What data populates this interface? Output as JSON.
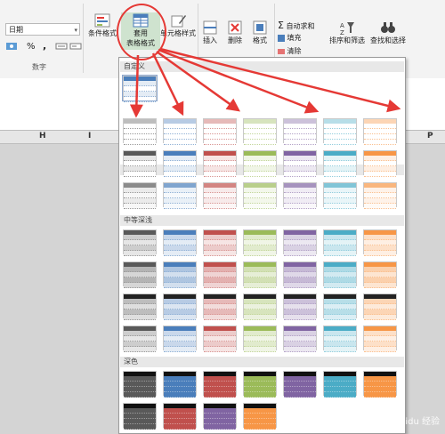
{
  "ribbon": {
    "number_format_value": "日期",
    "percent_symbol": "%",
    "comma_symbol": ",",
    "group_number_label": "数字",
    "conditional_format_label": "条件格式",
    "format_as_table_line1": "套用",
    "format_as_table_line2": "表格格式",
    "cell_styles_label": "单元格样式",
    "insert_label": "插入",
    "delete_label": "删除",
    "format_label": "格式",
    "autosum_label": "自动求和",
    "fill_label": "填充",
    "clear_label": "清除",
    "sort_filter_label": "排序和筛选",
    "find_select_label": "查找和选择"
  },
  "grid": {
    "col_h": "H",
    "col_i": "I",
    "col_p": "P"
  },
  "gallery": {
    "sections": [
      "自定义",
      "浅色",
      "中等深浅",
      "深色"
    ]
  },
  "watermark": "Baidu 经验",
  "colors": {
    "ribbon_bg": "#f3f3f3",
    "highlight_circle": "#e53935",
    "arrow": "#e53935",
    "accent_blue": "#4a7ebb",
    "accent_red": "#c0504d",
    "accent_green": "#9bbb59",
    "accent_purple": "#8064a2",
    "accent_teal": "#4bacc6",
    "accent_orange": "#f79646"
  }
}
